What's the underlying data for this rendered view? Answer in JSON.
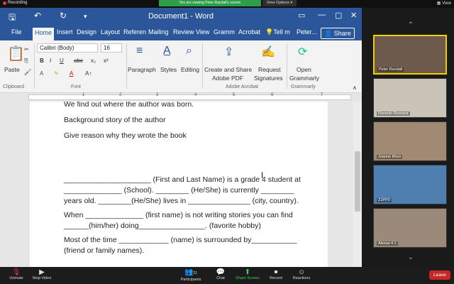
{
  "zoom_top": {
    "recording": "Recording",
    "share_banner": "You are viewing Peter Randall's screen",
    "view_options": "View Options ▾",
    "view": "View"
  },
  "word": {
    "title": "Document1 - Word",
    "tabs": [
      "File",
      "Home",
      "Insert",
      "Design",
      "Layout",
      "Referen",
      "Mailing",
      "Review",
      "View",
      "Gramm",
      "Acrobat",
      "Tell m",
      "Peter..."
    ],
    "share": "Share",
    "ribbon": {
      "paste": "Paste",
      "clipboard": "Clipboard",
      "font_name": "Calibri (Body)",
      "font_size": "16",
      "font_group": "Font",
      "paragraph": "Paragraph",
      "styles": "Styles",
      "editing": "Editing",
      "create_share": "Create and Share",
      "adobe_pdf": "Adobe PDF",
      "request": "Request",
      "signatures": "Signatures",
      "adobe_acrobat": "Adobe Acrobat",
      "open": "Open",
      "grammarly": "Grammarly",
      "grammarly_group": "Grammarly"
    },
    "ruler_numbers": [
      "1",
      "2",
      "3",
      "4",
      "5",
      "6",
      "7"
    ],
    "document_lines": [
      "We find out where the author was born.",
      "Background story of the author",
      "Give reason why they wrote the book",
      "_____________________ (First and Last Name) is a grade 4 student at",
      "______________ (School). ________ (He/She) is currently ________",
      "years old. ________(He/She) lives in _______________ (city, country).",
      "When ______________ (first name) is not writing stories you can find",
      "______(him/her) doing________________. (favorite hobby)",
      "Most of the time ____________ (name) is surrounded by___________",
      "(friend or family names)."
    ]
  },
  "participants": [
    {
      "name": "Peter Randall",
      "bg": "#6e5a4c"
    },
    {
      "name": "Romelio Romand",
      "bg": "#c9c3b8"
    },
    {
      "name": "Joanne Khoo",
      "bg": "#a08a73"
    },
    {
      "name": "Z1PP0",
      "bg": "#4f7fb0"
    },
    {
      "name": "Alessa 4.1",
      "bg": "#9b8a7a"
    }
  ],
  "bottom_bar": {
    "unmute": "Unmute",
    "stop_video": "Stop Video",
    "participants": "Participants",
    "participants_count": "21",
    "chat": "Chat",
    "share_screen": "Share Screen",
    "record": "Record",
    "reactions": "Reactions",
    "leave": "Leave"
  }
}
